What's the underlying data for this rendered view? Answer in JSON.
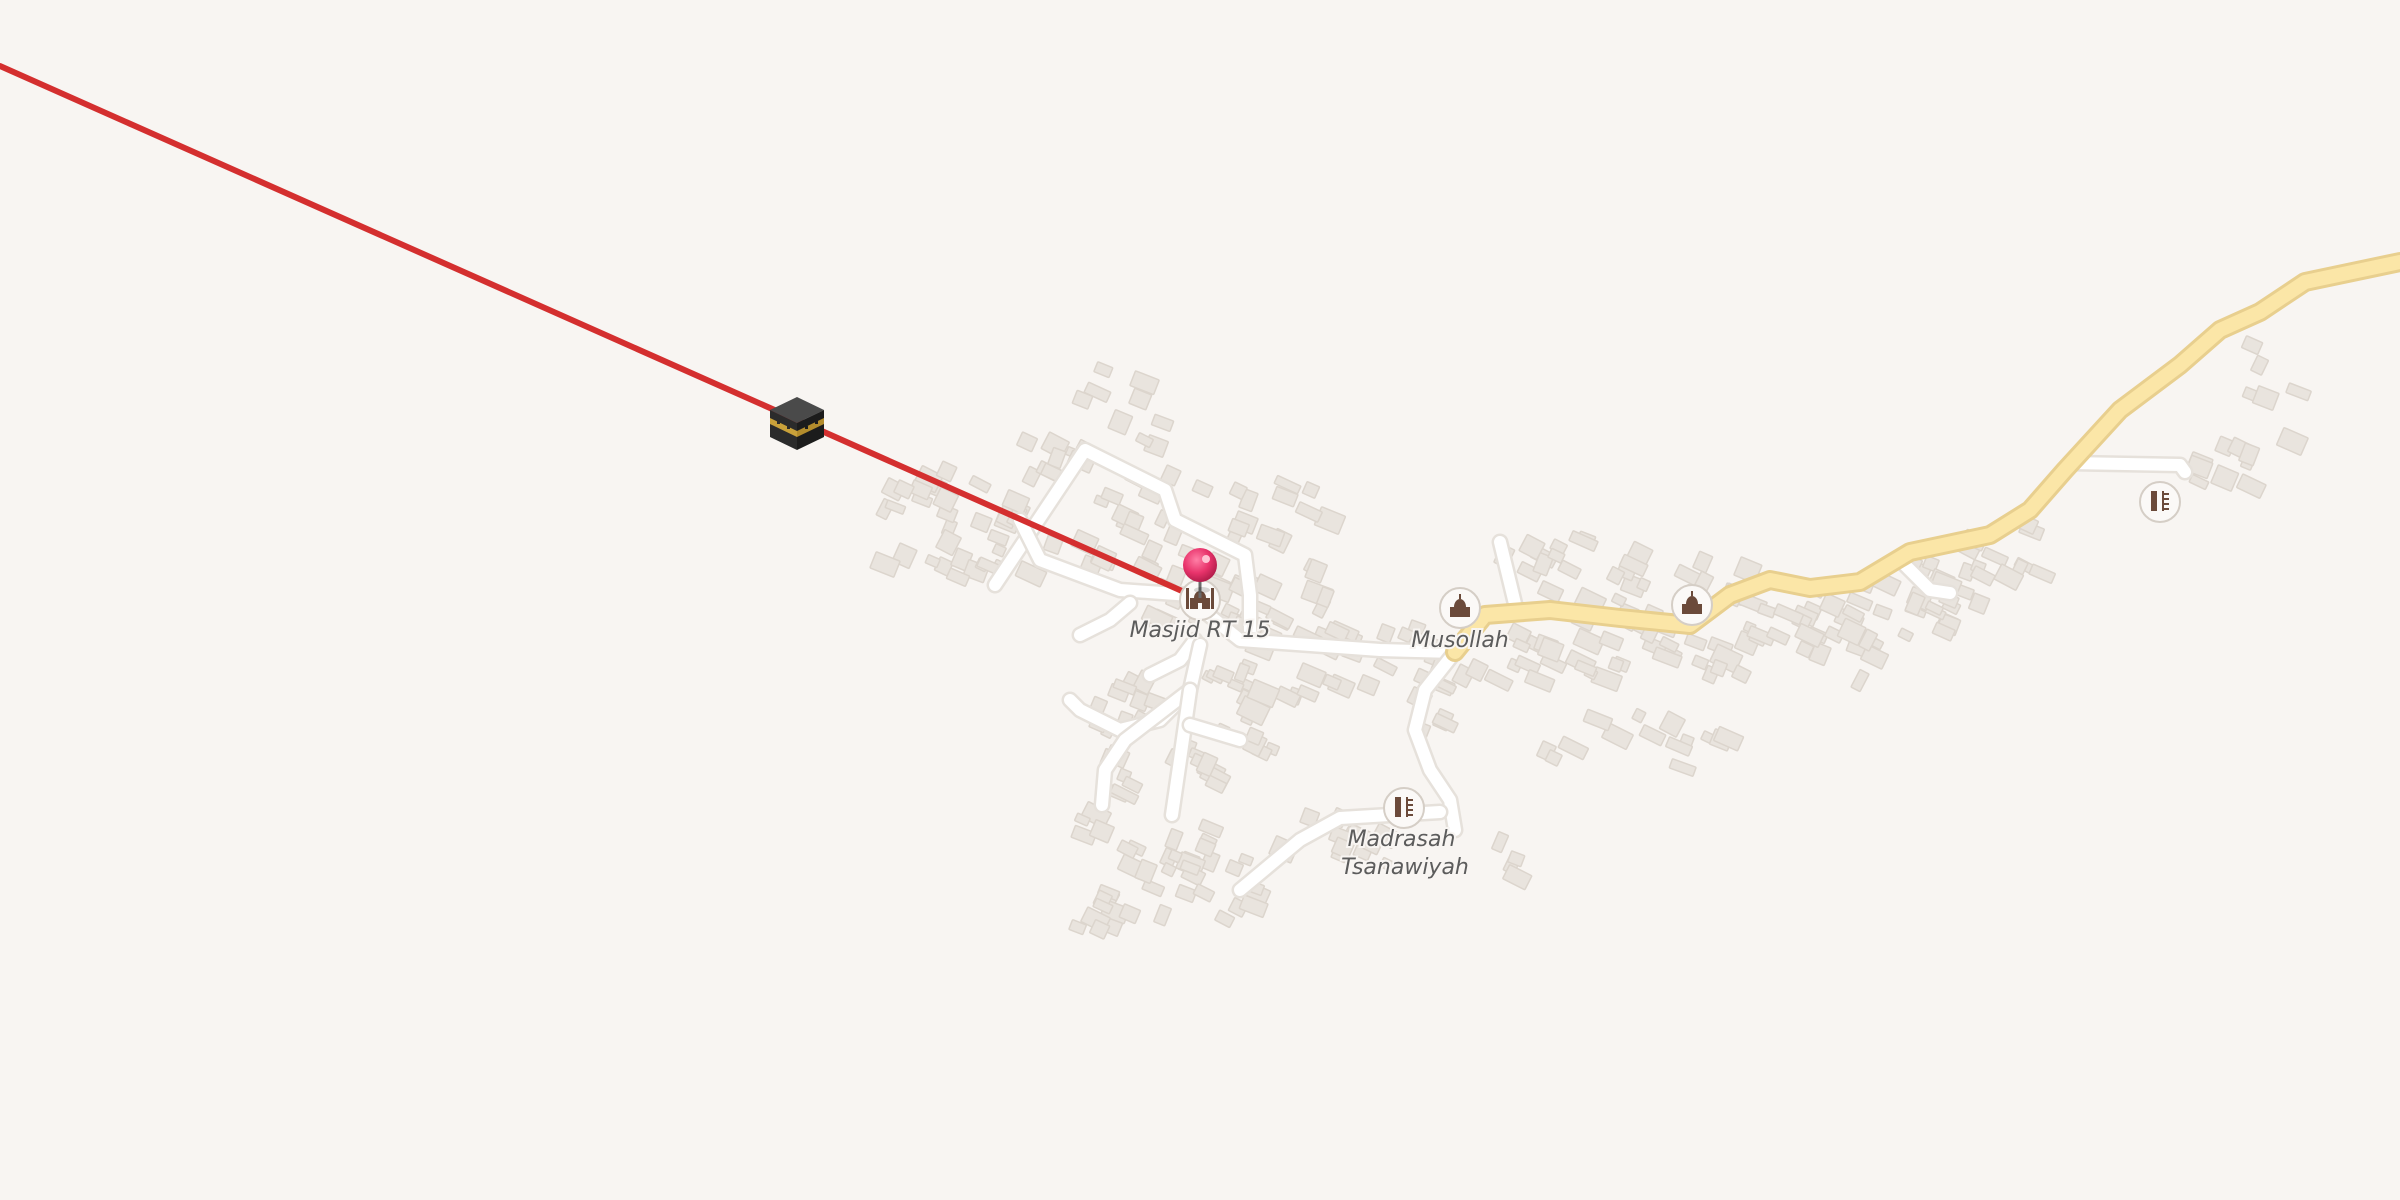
{
  "map": {
    "qibla_line_color": "#d42f2f",
    "main_road_color": "#fbe6a7",
    "minor_road_color": "#ffffff",
    "building_color": "#e9e4de",
    "pin_color": "#e8336b",
    "kaaba_marker": "kaaba-icon",
    "location_pin": "location-pin-icon"
  },
  "pois": [
    {
      "label": "Masjid RT 15",
      "icon": "mosque-icon"
    },
    {
      "label": "Musollah",
      "icon": "mosque-icon"
    },
    {
      "label": "",
      "icon": "mosque-icon"
    },
    {
      "label": "Madrasah Tsanawiyah",
      "lines": [
        "Madrasah",
        "Tsanawiyah"
      ],
      "icon": "school-icon"
    },
    {
      "label": "",
      "icon": "school-icon"
    }
  ]
}
